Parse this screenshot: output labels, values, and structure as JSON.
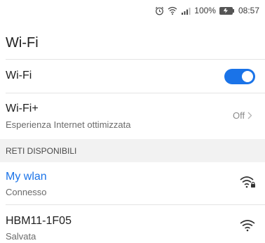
{
  "status_bar": {
    "battery": "100%",
    "time": "08:57",
    "icons": [
      "alarm-icon",
      "wifi-icon",
      "signal-icon",
      "battery-icon"
    ]
  },
  "header": {
    "title": "Wi-Fi"
  },
  "wifi_toggle": {
    "label": "Wi-Fi",
    "enabled": true
  },
  "wifi_plus": {
    "label": "Wi-Fi+",
    "subtitle": "Esperienza Internet ottimizzata",
    "value": "Off"
  },
  "available_section": {
    "label": "RETI DISPONIBILI"
  },
  "networks": [
    {
      "name": "My wlan",
      "status": "Connesso",
      "locked": true,
      "connected": true
    },
    {
      "name": "HBM11-1F05",
      "status": "Salvata",
      "locked": false,
      "connected": false
    }
  ],
  "colors": {
    "accent": "#1a73e8"
  }
}
